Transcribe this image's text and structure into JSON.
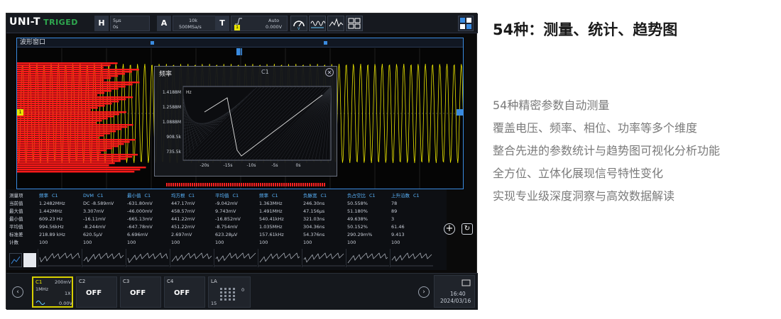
{
  "topbar": {
    "brand": "UNI-T",
    "brand_sub": "TRIGED",
    "h_key": "H",
    "h_timebase": "5μs",
    "h_offset": "0s",
    "a_key": "A",
    "a_points": "10k",
    "a_rate": "500MSa/s",
    "t_key": "T",
    "t_mode": "Auto",
    "t_level": "0.000V"
  },
  "wave_window": {
    "title": "波形窗口",
    "channel_marker": "1"
  },
  "popup": {
    "title": "频率",
    "channel": "C1",
    "close": "✕",
    "unit": "Hz",
    "y_ticks": [
      "1.4188M",
      "1.2588M",
      "1.0888M",
      "908.5k",
      "735.5k"
    ],
    "x_ticks": [
      "-20s",
      "-15s",
      "-10s",
      "-5s",
      "0s"
    ]
  },
  "table": {
    "row_labels": [
      "测量项",
      "当前值",
      "最大值",
      "最小值",
      "平均值",
      "标准差",
      "计数"
    ],
    "columns": [
      {
        "name": "频率",
        "ch": "C1",
        "values": [
          "1.2482MHz",
          "1.442MHz",
          "609.23 Hz",
          "994.56kHz",
          "218.89 kHz",
          "100"
        ]
      },
      {
        "name": "DVM",
        "ch": "C1",
        "values": [
          "DC -8.589mV",
          "3.307mV",
          "-16.11mV",
          "-8.244mV",
          "620.5μV",
          "100"
        ]
      },
      {
        "name": "最小值",
        "ch": "C1",
        "values": [
          "-631.80mV",
          "-46.000mV",
          "-665.13mV",
          "-647.78mV",
          "6.696mV",
          "100"
        ]
      },
      {
        "name": "均方根",
        "ch": "C1",
        "values": [
          "447.17mV",
          "458.57mV",
          "441.22mV",
          "451.22mV",
          "2.697mV",
          "100"
        ]
      },
      {
        "name": "平均值",
        "ch": "C1",
        "values": [
          "-9.042mV",
          "9.743mV",
          "-16.852mV",
          "-8.754mV",
          "623.28μV",
          "100"
        ]
      },
      {
        "name": "频率",
        "ch": "C1",
        "values": [
          "1.363MHz",
          "1.491MHz",
          "540.41kHz",
          "1.035MHz",
          "157.61kHz",
          "100"
        ]
      },
      {
        "name": "负脉宽",
        "ch": "C1",
        "values": [
          "246.30ns",
          "47.156μs",
          "321.03ns",
          "304.36ns",
          "54.376ns",
          "100"
        ]
      },
      {
        "name": "负占空比",
        "ch": "C1",
        "values": [
          "50.558%",
          "51.180%",
          "49.638%",
          "50.152%",
          "290.29m%",
          "100"
        ]
      },
      {
        "name": "上升沿数",
        "ch": "C1",
        "values": [
          "78",
          "89",
          "3",
          "61.46",
          "9.413",
          "100"
        ]
      }
    ]
  },
  "channels": [
    {
      "name": "C1",
      "state": "200mV 1MHz 1X 0.00V",
      "v_div": "200mV",
      "bw": "1MHz",
      "probe": "1X",
      "offset": "0.00V"
    },
    {
      "name": "C2",
      "state": "OFF"
    },
    {
      "name": "C3",
      "state": "OFF"
    },
    {
      "name": "C4",
      "state": "OFF"
    },
    {
      "name": "LA",
      "state": "",
      "la_a": "0",
      "la_b": "15"
    }
  ],
  "clock": {
    "time": "16:40",
    "date": "2024/03/16"
  },
  "right_panel": {
    "title": "54种：测量、统计、趋势图",
    "lines": [
      "54种精密参数自动测量",
      "覆盖电压、频率、相位、功率等多个维度",
      "整合先进的参数统计与趋势图可视化分析功能",
      "全方位、立体化展现信号特性变化",
      "实现专业级深度洞察与高效数据解读"
    ]
  },
  "colors": {
    "accent": "#3a8be0",
    "ch1": "#e9e400",
    "table_header": "#5bb6ff",
    "red_fill": "#ff1a1a"
  }
}
